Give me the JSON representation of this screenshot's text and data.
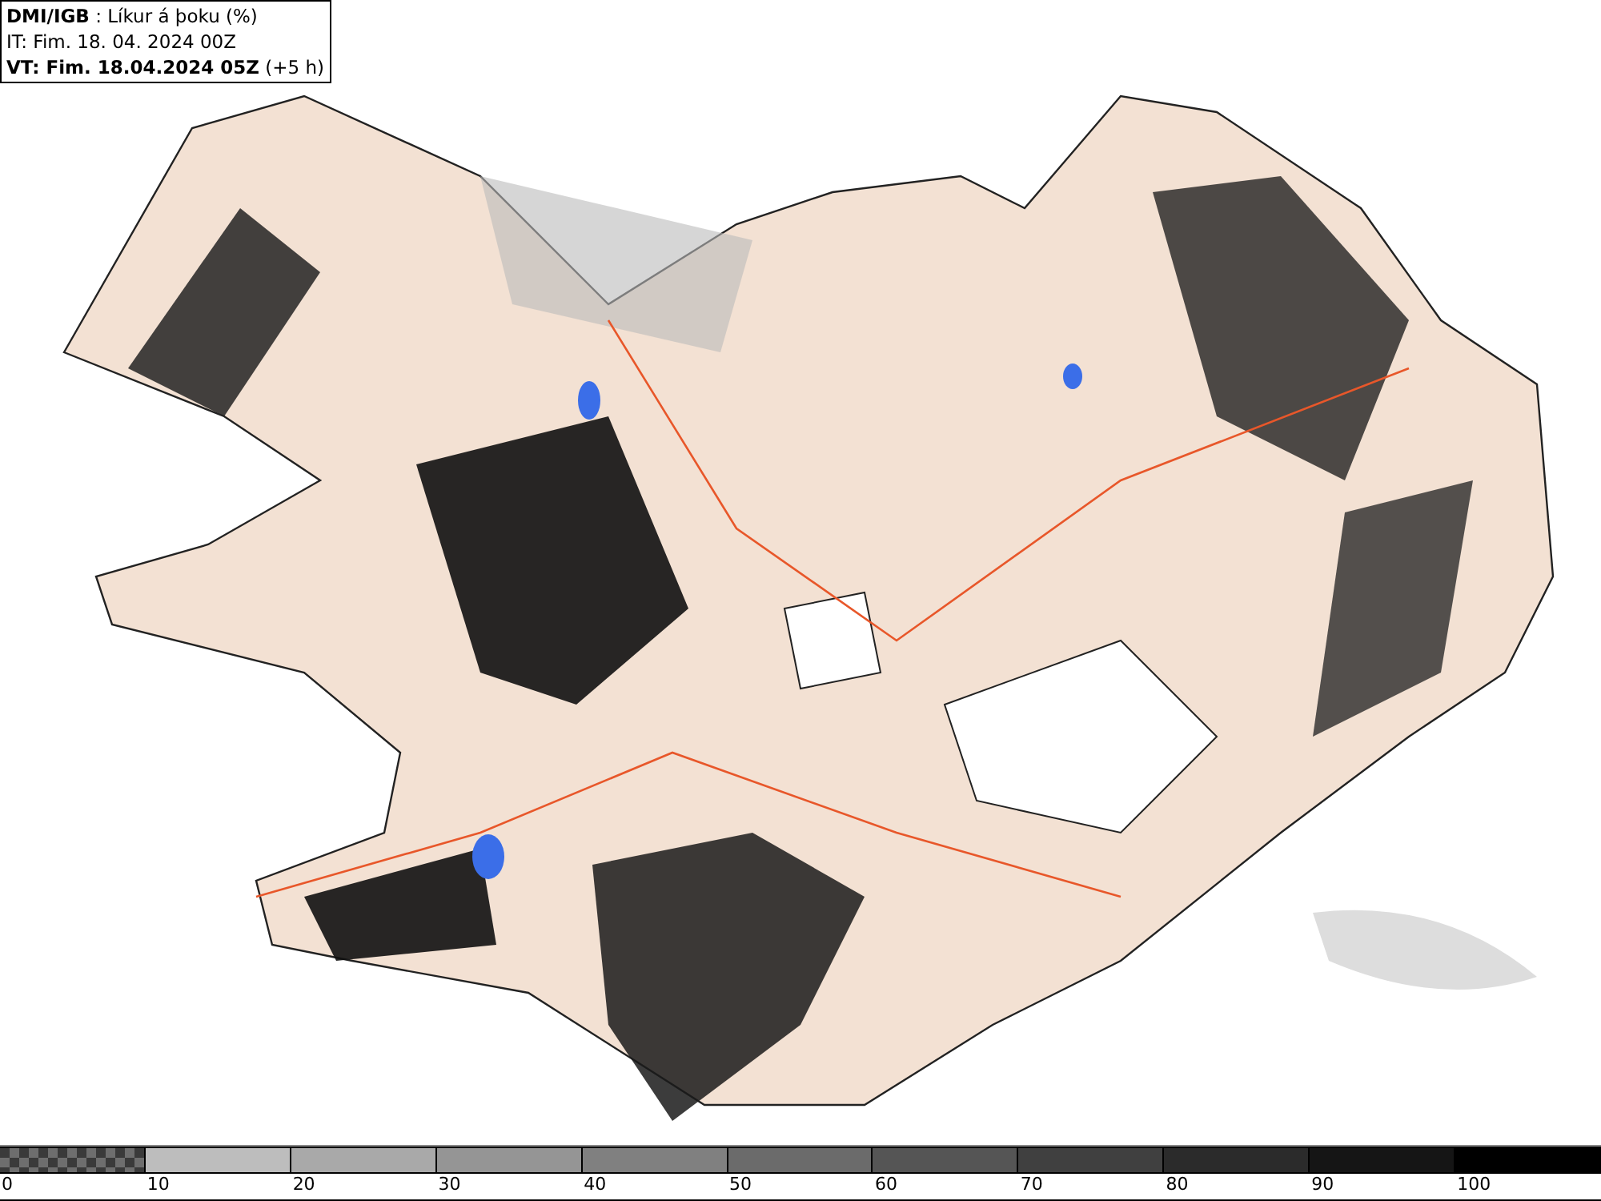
{
  "info_box": {
    "lines": [
      "**DMI/IGB** : Líkur á þoku (%)",
      "IT: Fim. 18. 04. 2024 00Z",
      "**VT: Fim. 18.04.2024 05Z** (+5 h)"
    ]
  },
  "legend": [
    {
      "kind": "pattern",
      "color": "#6e6e6e",
      "label": "0"
    },
    {
      "kind": "solid",
      "color": "#bdbdbd",
      "label": "10"
    },
    {
      "kind": "solid",
      "color": "#a9a9a9",
      "label": "20"
    },
    {
      "kind": "solid",
      "color": "#959595",
      "label": "30"
    },
    {
      "kind": "solid",
      "color": "#808080",
      "label": "40"
    },
    {
      "kind": "solid",
      "color": "#6b6b6b",
      "label": "50"
    },
    {
      "kind": "solid",
      "color": "#555555",
      "label": "60"
    },
    {
      "kind": "solid",
      "color": "#404040",
      "label": "70"
    },
    {
      "kind": "solid",
      "color": "#2b2b2b",
      "label": "80"
    },
    {
      "kind": "solid",
      "color": "#151515",
      "label": "90"
    },
    {
      "kind": "solid",
      "color": "#000000",
      "label": "100"
    }
  ]
}
